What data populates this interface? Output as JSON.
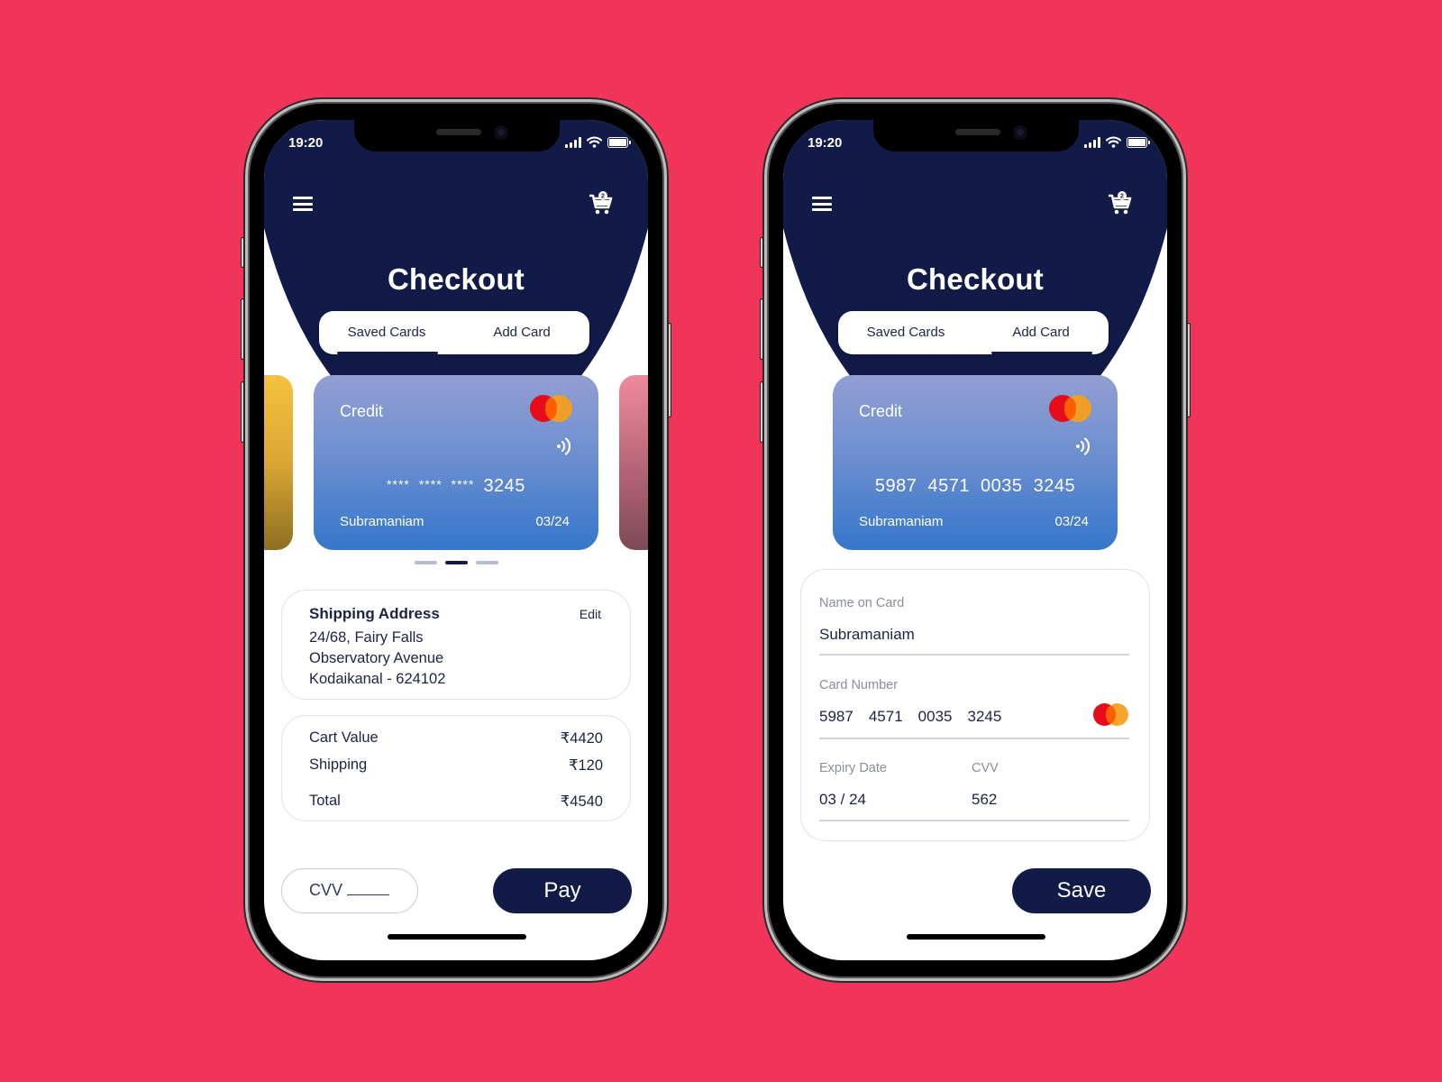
{
  "background_color": "#f0345a",
  "brand_color": "#121a48",
  "screens": [
    {
      "status_bar": {
        "time": "19:20"
      },
      "header": {
        "title": "Checkout",
        "cart_count": "2"
      },
      "tabs": [
        {
          "label": "Saved Cards",
          "active": true
        },
        {
          "label": "Add Card",
          "active": false
        }
      ],
      "card": {
        "type": "Credit",
        "brand": "mastercard",
        "number_mask": [
          "****",
          "****",
          "****"
        ],
        "number_last4": "3245",
        "holder": "Subramaniam",
        "expiry": "03/24"
      },
      "carousel": {
        "count": 3,
        "active_index": 1
      },
      "shipping": {
        "title": "Shipping Address",
        "edit_label": "Edit",
        "lines": [
          "24/68, Fairy Falls",
          "Observatory Avenue",
          "Kodaikanal - 624102"
        ]
      },
      "summary": {
        "rows": [
          {
            "label": "Cart Value",
            "value": "₹4420"
          },
          {
            "label": "Shipping",
            "value": "₹120"
          },
          {
            "label": "Total",
            "value": "₹4540"
          }
        ]
      },
      "cvv_input": {
        "placeholder": "CVV"
      },
      "pay_label": "Pay"
    },
    {
      "status_bar": {
        "time": "19:20"
      },
      "header": {
        "title": "Checkout",
        "cart_count": "2"
      },
      "tabs": [
        {
          "label": "Saved Cards",
          "active": false
        },
        {
          "label": "Add Card",
          "active": true
        }
      ],
      "card": {
        "type": "Credit",
        "brand": "mastercard",
        "number": "5987  4571  0035  3245",
        "holder": "Subramaniam",
        "expiry": "03/24"
      },
      "form": {
        "name_label": "Name on Card",
        "name_value": "Subramaniam",
        "number_label": "Card Number",
        "number_groups": [
          "5987",
          "4571",
          "0035",
          "3245"
        ],
        "expiry_label": "Expiry Date",
        "expiry_value": "03 / 24",
        "cvv_label": "CVV",
        "cvv_value": "562"
      },
      "save_label": "Save"
    }
  ]
}
